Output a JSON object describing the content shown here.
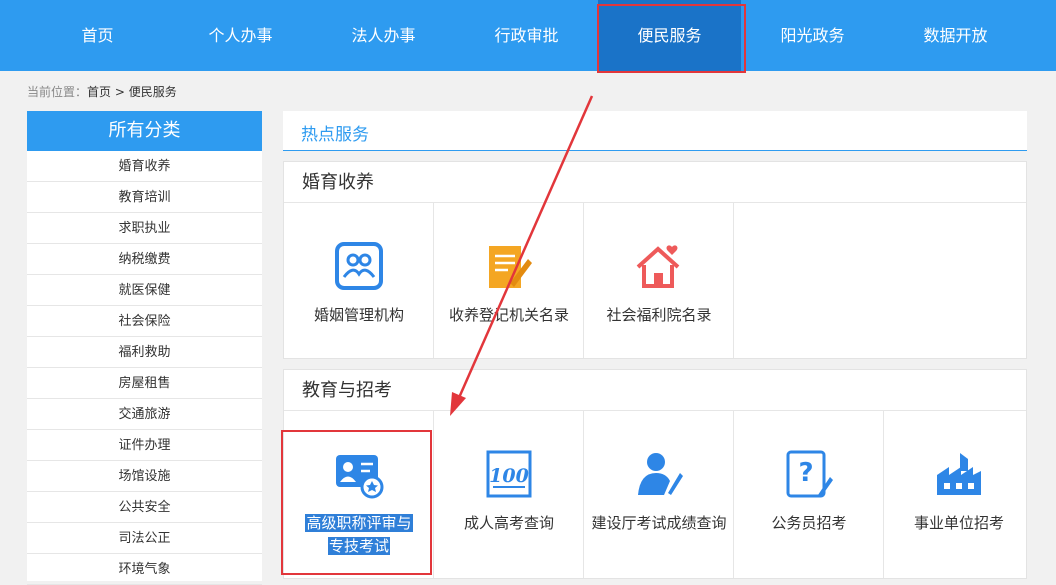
{
  "nav": {
    "items": [
      "首页",
      "个人办事",
      "法人办事",
      "行政审批",
      "便民服务",
      "阳光政务",
      "数据开放"
    ],
    "active_index": 4
  },
  "breadcrumb": {
    "prefix": "当前位置：",
    "home": "首页",
    "sep": " > ",
    "current": "便民服务"
  },
  "sidebar": {
    "title": "所有分类",
    "items": [
      "婚育收养",
      "教育培训",
      "求职执业",
      "纳税缴费",
      "就医保健",
      "社会保险",
      "福利救助",
      "房屋租售",
      "交通旅游",
      "证件办理",
      "场馆设施",
      "公共安全",
      "司法公正",
      "环境气象"
    ]
  },
  "hot": {
    "title": "热点服务"
  },
  "panel_marriage": {
    "title": "婚育收养",
    "cards": [
      {
        "label": "婚姻管理机构",
        "icon": "couple-icon"
      },
      {
        "label": "收养登记机关名录",
        "icon": "document-pen-icon"
      },
      {
        "label": "社会福利院名录",
        "icon": "house-heart-icon"
      }
    ]
  },
  "panel_education": {
    "title": "教育与招考",
    "cards": [
      {
        "label": "高级职称评审与专技考试",
        "label_line1": "高级职称评审与",
        "label_line2": "专技考试",
        "icon": "id-card-star-icon"
      },
      {
        "label": "成人高考查询",
        "icon": "score-100-icon"
      },
      {
        "label": "建设厅考试成绩查询",
        "icon": "person-pen-icon"
      },
      {
        "label": "公务员招考",
        "icon": "question-doc-icon"
      },
      {
        "label": "事业单位招考",
        "icon": "factory-icon"
      }
    ]
  },
  "colors": {
    "nav_bg": "#2e9bf0",
    "nav_active": "#1a73c8",
    "highlight": "#e2363b",
    "icon_blue": "#2e86e6",
    "icon_orange": "#f4a623",
    "icon_red": "#ee5a5a"
  }
}
